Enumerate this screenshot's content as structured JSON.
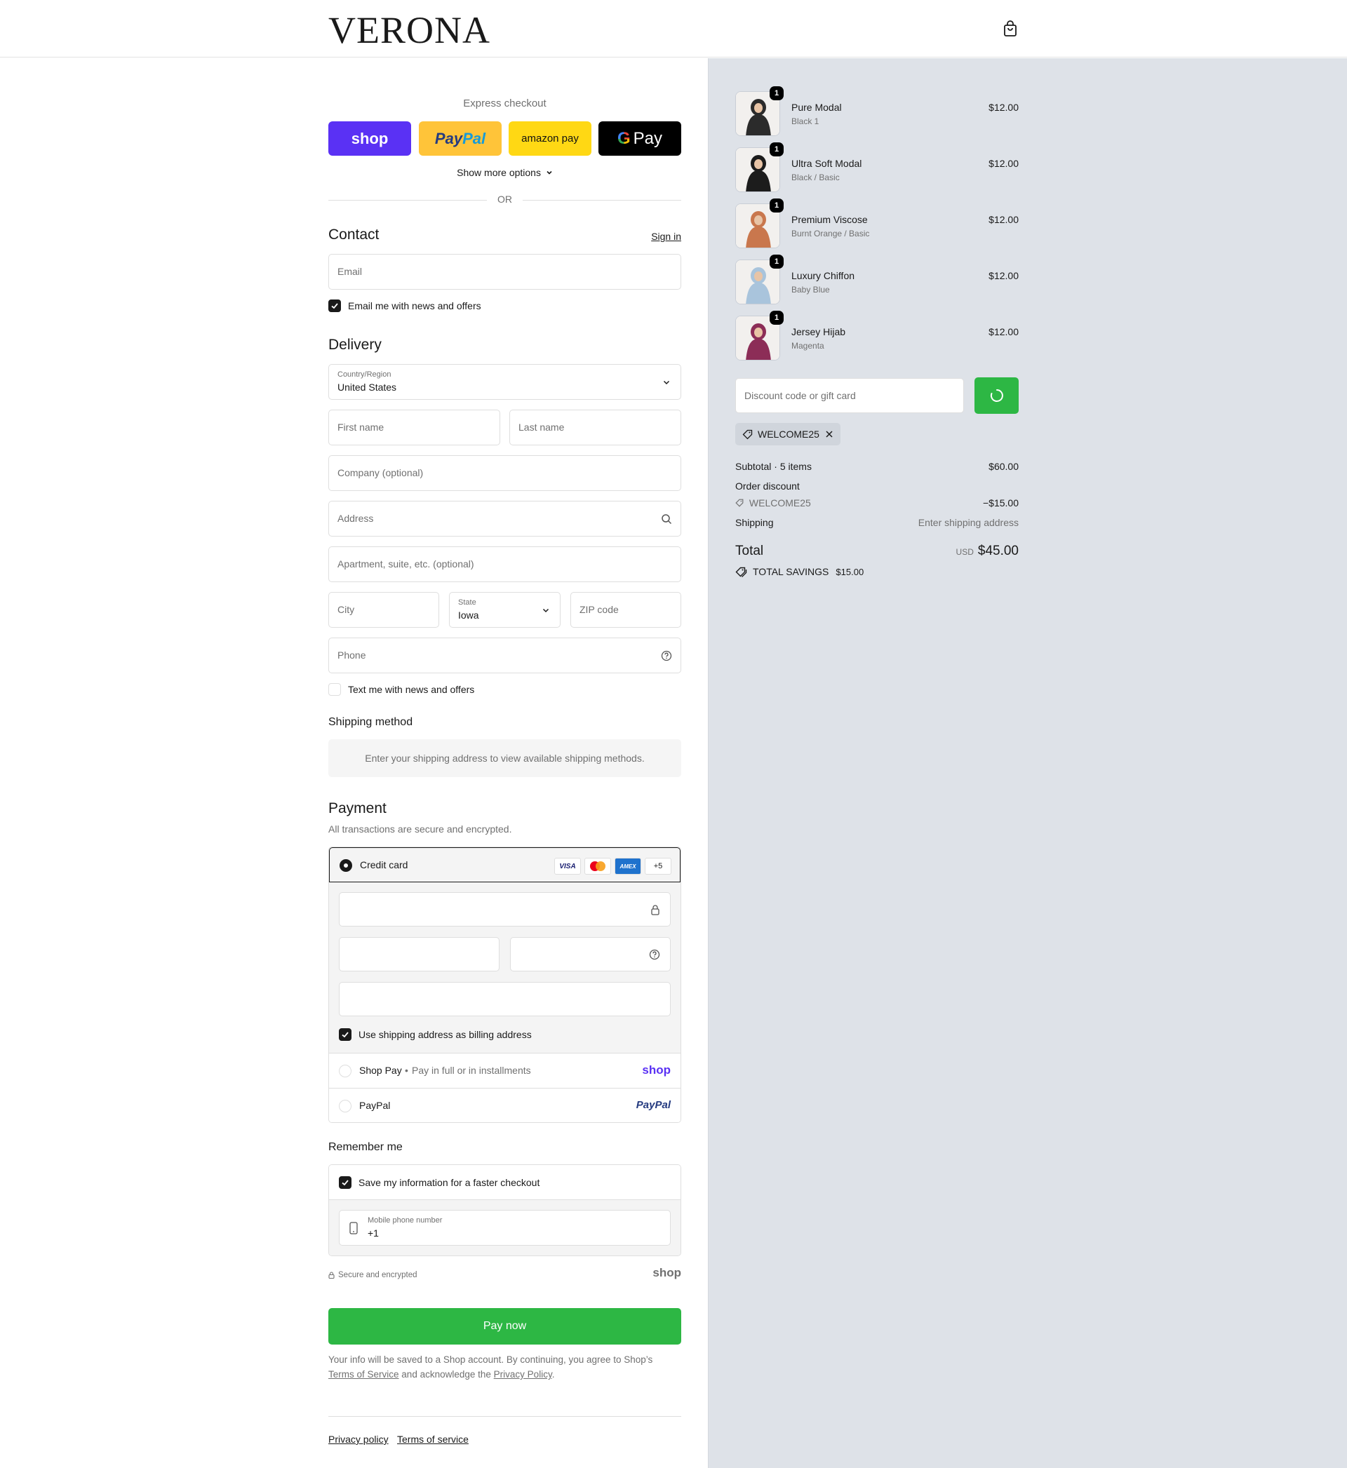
{
  "header": {
    "logo": "VERONA",
    "cart_icon": "shopping-bag-icon"
  },
  "express": {
    "title": "Express checkout",
    "buttons": {
      "shop": "shop",
      "paypal_a": "Pay",
      "paypal_b": "Pal",
      "amazon": "amazon pay",
      "gpay_g": "G",
      "gpay": "Pay"
    },
    "more_options": "Show more options",
    "or": "OR"
  },
  "contact": {
    "heading": "Contact",
    "sign_in": "Sign in",
    "email_placeholder": "Email",
    "news_label": "Email me with news and offers"
  },
  "delivery": {
    "heading": "Delivery",
    "country_label": "Country/Region",
    "country_value": "United States",
    "first_name": "First name",
    "last_name": "Last name",
    "company": "Company (optional)",
    "address": "Address",
    "apartment": "Apartment, suite, etc. (optional)",
    "city": "City",
    "state_label": "State",
    "state_value": "Iowa",
    "zip": "ZIP code",
    "phone": "Phone",
    "text_label": "Text me with news and offers"
  },
  "shipping_method": {
    "heading": "Shipping method",
    "notice": "Enter your shipping address to view available shipping methods."
  },
  "payment": {
    "heading": "Payment",
    "subtitle": "All transactions are secure and encrypted.",
    "credit_card": "Credit card",
    "badges": {
      "visa": "VISA",
      "amex": "AMEX",
      "more": "+5"
    },
    "billing_label": "Use shipping address as billing address",
    "shop_pay": "Shop Pay",
    "shop_pay_desc": "Pay in full or in installments",
    "shop_pay_logo": "shop",
    "paypal": "PayPal",
    "paypal_logo": "PayPal"
  },
  "remember": {
    "heading": "Remember me",
    "save_label": "Save my information for a faster checkout",
    "mobile_label": "Mobile phone number",
    "mobile_value": "+1",
    "secure": "Secure and encrypted",
    "shop_logo": "shop"
  },
  "pay_now": "Pay now",
  "legal": {
    "text1": "Your info will be saved to a Shop account. By continuing, you agree to Shop’s",
    "terms": "Terms of Service",
    "text2": "and acknowledge the",
    "privacy": "Privacy Policy",
    "text3": "."
  },
  "footer": {
    "privacy": "Privacy policy",
    "terms": "Terms of service"
  },
  "cart": {
    "items": [
      {
        "name": "Pure Modal",
        "variant": "Black 1",
        "price": "$12.00",
        "qty": "1",
        "color": "#2b2b2b"
      },
      {
        "name": "Ultra Soft Modal",
        "variant": "Black / Basic",
        "price": "$12.00",
        "qty": "1",
        "color": "#1c1c1c"
      },
      {
        "name": "Premium Viscose",
        "variant": "Burnt Orange / Basic",
        "price": "$12.00",
        "qty": "1",
        "color": "#c9774d"
      },
      {
        "name": "Luxury Chiffon",
        "variant": "Baby Blue",
        "price": "$12.00",
        "qty": "1",
        "color": "#a9c4dc"
      },
      {
        "name": "Jersey Hijab",
        "variant": "Magenta",
        "price": "$12.00",
        "qty": "1",
        "color": "#8c2d57"
      }
    ],
    "discount_placeholder": "Discount code or gift card",
    "applied_code": "WELCOME25",
    "subtotal_label": "Subtotal · 5 items",
    "subtotal_value": "$60.00",
    "order_discount_label": "Order discount",
    "discount_code": "WELCOME25",
    "discount_value": "−$15.00",
    "shipping_label": "Shipping",
    "shipping_value": "Enter shipping address",
    "total_label": "Total",
    "currency": "USD",
    "total_value": "$45.00",
    "savings_label": "TOTAL SAVINGS",
    "savings_value": "$15.00"
  },
  "colors": {
    "accent_green": "#2db744",
    "shop_purple": "#5a31f4",
    "summary_bg": "#dee2e8"
  }
}
